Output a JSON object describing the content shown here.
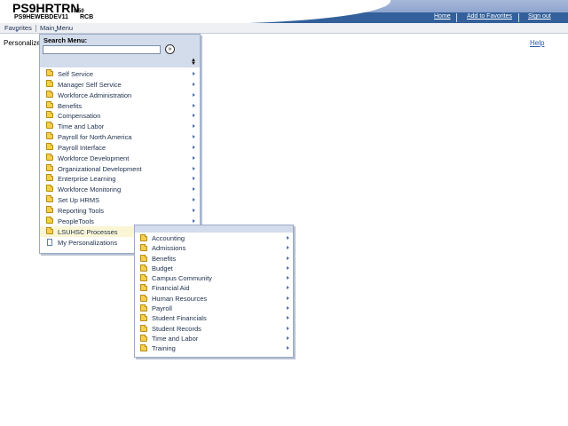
{
  "header": {
    "app_title": "PS9HRTRN",
    "app_version": "8.50",
    "db_name": "PS9HEWEBDEV11",
    "user_id": "RCB",
    "links": [
      "Home",
      "Add to Favorites",
      "Sign out"
    ]
  },
  "menubar": {
    "favorites": "Favorites",
    "main_menu": "Main Menu"
  },
  "page": {
    "personalize_text": "Personalize",
    "help_link": "Help"
  },
  "main_menu": {
    "search_label": "Search Menu:",
    "search_value": "",
    "search_go": "»",
    "items": [
      {
        "label": "Self Service",
        "icon": "folder-icon"
      },
      {
        "label": "Manager Self Service",
        "icon": "folder-icon"
      },
      {
        "label": "Workforce Administration",
        "icon": "folder-icon"
      },
      {
        "label": "Benefits",
        "icon": "folder-icon"
      },
      {
        "label": "Compensation",
        "icon": "folder-icon"
      },
      {
        "label": "Time and Labor",
        "icon": "folder-icon"
      },
      {
        "label": "Payroll for North America",
        "icon": "folder-icon"
      },
      {
        "label": "Payroll Interface",
        "icon": "folder-icon"
      },
      {
        "label": "Workforce Development",
        "icon": "folder-icon"
      },
      {
        "label": "Organizational Development",
        "icon": "folder-icon"
      },
      {
        "label": "Enterprise Learning",
        "icon": "folder-icon"
      },
      {
        "label": "Workforce Monitoring",
        "icon": "folder-icon"
      },
      {
        "label": "Set Up HRMS",
        "icon": "folder-icon"
      },
      {
        "label": "Reporting Tools",
        "icon": "folder-icon"
      },
      {
        "label": "PeopleTools",
        "icon": "folder-icon"
      },
      {
        "label": "LSUHSC Processes",
        "icon": "folder-icon"
      },
      {
        "label": "My Personalizations",
        "icon": "page-icon"
      }
    ]
  },
  "sub_menu": {
    "items": [
      "Accounting",
      "Admissions",
      "Benefits",
      "Budget",
      "Campus Community",
      "Financial Aid",
      "Human Resources",
      "Payroll",
      "Student Financials",
      "Student Records",
      "Time and Labor",
      "Training"
    ]
  },
  "colors": {
    "banner_dark": "#33609a",
    "banner_light": "#8ea4cf",
    "menu_panel": "#d3dceb",
    "highlight": "#faf6d5"
  }
}
